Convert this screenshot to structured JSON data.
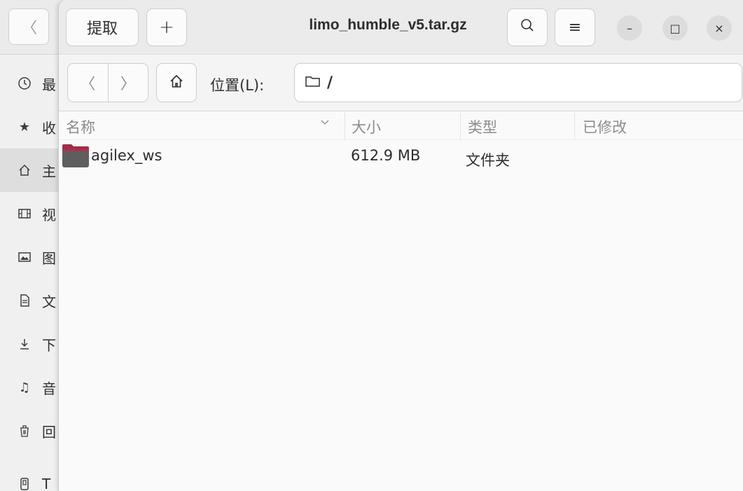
{
  "background_window": {
    "sidebar": {
      "items": [
        {
          "icon": "clock-icon",
          "label": "最"
        },
        {
          "icon": "star-icon",
          "label": "收"
        },
        {
          "icon": "home-icon",
          "label": "主"
        },
        {
          "icon": "film-icon",
          "label": "视"
        },
        {
          "icon": "image-icon",
          "label": "图"
        },
        {
          "icon": "document-icon",
          "label": "文"
        },
        {
          "icon": "download-icon",
          "label": "下"
        },
        {
          "icon": "music-icon",
          "label": "音"
        },
        {
          "icon": "trash-icon",
          "label": "回"
        },
        {
          "icon": "drive-icon",
          "label": "T"
        }
      ]
    }
  },
  "archive_window": {
    "title": "limo_humble_v5.tar.gz",
    "toolbar": {
      "extract_label": "提取",
      "add_label": "+",
      "menu_label": "≡"
    },
    "window_controls": {
      "minimize": "–",
      "maximize": "□",
      "close": "×"
    },
    "location": {
      "label": "位置(L):",
      "path": "/"
    },
    "columns": {
      "name": "名称",
      "size": "大小",
      "type": "类型",
      "modified": "已修改"
    },
    "rows": [
      {
        "name": "agilex_ws",
        "size": "612.9 MB",
        "type": "文件夹",
        "modified": ""
      }
    ]
  }
}
